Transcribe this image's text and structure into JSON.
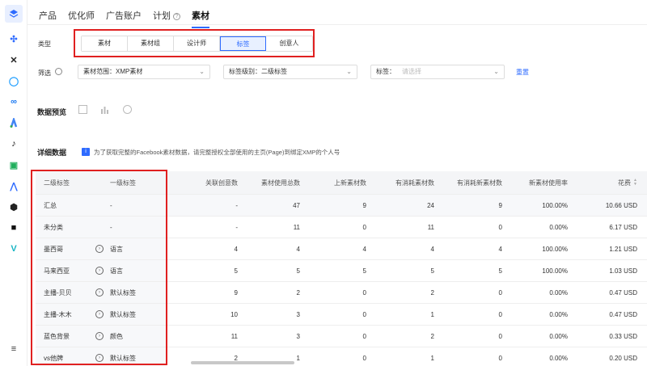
{
  "rail_icons": [
    "layers-icon",
    "ad-platform-icon",
    "x-platform-icon",
    "o-platform-icon",
    "meta-icon",
    "google-ads-icon",
    "tiktok-icon",
    "doc-icon",
    "a-platform-icon",
    "cube-icon",
    "snap-icon",
    "v-platform-icon",
    "menu-icon"
  ],
  "tabs": [
    {
      "label": "产品",
      "active": false
    },
    {
      "label": "优化师",
      "active": false
    },
    {
      "label": "广告账户",
      "active": false
    },
    {
      "label": "计划",
      "active": false,
      "help": "?"
    },
    {
      "label": "素材",
      "active": true
    }
  ],
  "type_label": "类型",
  "type_options": [
    {
      "label": "素材",
      "active": false
    },
    {
      "label": "素材组",
      "active": false
    },
    {
      "label": "设计师",
      "active": false
    },
    {
      "label": "标签",
      "active": true
    },
    {
      "label": "创意人",
      "active": false
    }
  ],
  "filter_label": "筛选",
  "filters": {
    "range": "素材范围：XMP素材",
    "level": "标签级别：二级标签",
    "tag_label": "标签：",
    "tag_placeholder": "请选择"
  },
  "reset_label": "重置",
  "preview_title": "数据预览",
  "detail_title": "详细数据",
  "info_text": "为了获取完整的Facebook素材数据，请完整授权全部使用的主页(Page)到绑定XMP的个人号",
  "table": {
    "headers": [
      "二级标签",
      "一级标签",
      "关联创意数",
      "素材使用总数",
      "上新素材数",
      "有消耗素材数",
      "有消耗新素材数",
      "新素材使用率",
      "花费"
    ],
    "rows": [
      {
        "tag2": "汇总",
        "tag1": "-",
        "cols": [
          "-",
          "47",
          "9",
          "24",
          "9",
          "100.00%",
          "10.66 USD"
        ],
        "info": false
      },
      {
        "tag2": "未分类",
        "tag1": "-",
        "cols": [
          "-",
          "11",
          "0",
          "11",
          "0",
          "0.00%",
          "6.17 USD"
        ],
        "info": false
      },
      {
        "tag2": "墨西哥",
        "tag1": "语言",
        "cols": [
          "4",
          "4",
          "4",
          "4",
          "4",
          "100.00%",
          "1.21 USD"
        ],
        "info": true
      },
      {
        "tag2": "马来西亚",
        "tag1": "语言",
        "cols": [
          "5",
          "5",
          "5",
          "5",
          "5",
          "100.00%",
          "1.03 USD"
        ],
        "info": true
      },
      {
        "tag2": "主播-贝贝",
        "tag1": "默认标签",
        "cols": [
          "9",
          "2",
          "0",
          "2",
          "0",
          "0.00%",
          "0.47 USD"
        ],
        "info": true
      },
      {
        "tag2": "主播-木木",
        "tag1": "默认标签",
        "cols": [
          "10",
          "3",
          "0",
          "1",
          "0",
          "0.00%",
          "0.47 USD"
        ],
        "info": true
      },
      {
        "tag2": "蓝色背景",
        "tag1": "颜色",
        "cols": [
          "11",
          "3",
          "0",
          "2",
          "0",
          "0.00%",
          "0.33 USD"
        ],
        "info": true
      },
      {
        "tag2": "vs他牌",
        "tag1": "默认标签",
        "cols": [
          "2",
          "1",
          "0",
          "1",
          "0",
          "0.00%",
          "0.20 USD"
        ],
        "info": true
      }
    ]
  },
  "colors": {
    "accent": "#2e6bff",
    "highlight": "#e02020"
  }
}
